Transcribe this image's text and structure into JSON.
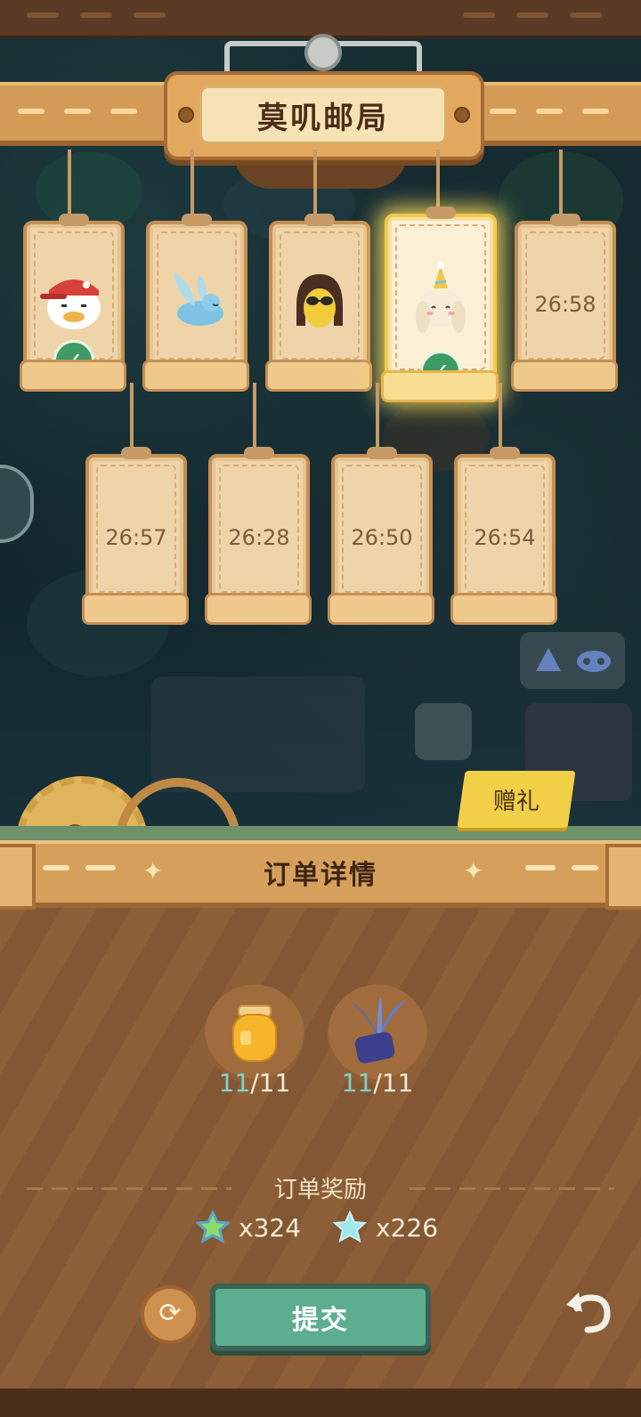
{
  "header": {
    "title": "莫叽邮局"
  },
  "orders": [
    {
      "id": "order-1",
      "status": "completed",
      "portrait": "duck-cap-portrait"
    },
    {
      "id": "order-2",
      "status": "available",
      "portrait": "blue-bird-portrait"
    },
    {
      "id": "order-3",
      "status": "available",
      "portrait": "sunglasses-lemon-portrait"
    },
    {
      "id": "order-4",
      "status": "completed",
      "portrait": "party-bunny-portrait",
      "selected": true
    },
    {
      "id": "order-5",
      "status": "cooldown",
      "timer": "26:58"
    },
    {
      "id": "order-6",
      "status": "cooldown",
      "timer": "26:57"
    },
    {
      "id": "order-7",
      "status": "cooldown",
      "timer": "26:28"
    },
    {
      "id": "order-8",
      "status": "cooldown",
      "timer": "26:50"
    },
    {
      "id": "order-9",
      "status": "cooldown",
      "timer": "26:54"
    }
  ],
  "gift": {
    "label": "赠礼"
  },
  "details": {
    "title": "订单详情",
    "items": [
      {
        "icon": "honey-jar-icon",
        "have": "11",
        "need": "/11"
      },
      {
        "icon": "blue-plant-pot-icon",
        "have": "11",
        "need": "/11"
      }
    ],
    "reward_title": "订单奖励",
    "rewards": [
      {
        "icon": "green-star-icon",
        "amount": "x324"
      },
      {
        "icon": "blue-star-icon",
        "amount": "x226"
      }
    ]
  },
  "actions": {
    "submit": "提交",
    "refresh_icon": "refresh-icon",
    "back_icon": "back-arrow-icon"
  },
  "colors": {
    "wood": "#d39b56",
    "submit": "#5cae8f",
    "check": "#3f9a63",
    "highlight": "#f4c94b"
  }
}
